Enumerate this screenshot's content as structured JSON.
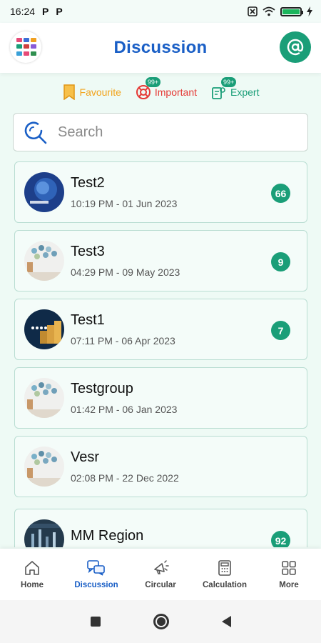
{
  "status_bar": {
    "time": "16:24",
    "notif_1": "P",
    "notif_2": "P"
  },
  "header": {
    "title": "Discussion"
  },
  "filters": {
    "favourite": {
      "label": "Favourite",
      "color": "#f2a31b"
    },
    "important": {
      "label": "Important",
      "badge": "99+",
      "color": "#e53935"
    },
    "expert": {
      "label": "Expert",
      "badge": "99+",
      "color": "#1a9e78"
    }
  },
  "search": {
    "placeholder": "Search"
  },
  "discussions": [
    {
      "title": "Test2",
      "time": "10:19 PM - 01 Jun 2023",
      "count": "66",
      "avatar": "ai-blue"
    },
    {
      "title": "Test3",
      "time": "04:29 PM - 09 May 2023",
      "count": "9",
      "avatar": "tree"
    },
    {
      "title": "Test1",
      "time": "07:11 PM - 06 Apr 2023",
      "count": "7",
      "avatar": "coins"
    },
    {
      "title": "Testgroup",
      "time": "01:42 PM - 06 Jan 2023",
      "count": "",
      "avatar": "tree"
    },
    {
      "title": "Vesr",
      "time": "02:08 PM - 22 Dec 2022",
      "count": "",
      "avatar": "tree"
    },
    {
      "title": "MM Region",
      "time": "",
      "count": "92",
      "avatar": "dark"
    }
  ],
  "bottom_nav": [
    {
      "label": "Home",
      "icon": "home-icon",
      "active": false
    },
    {
      "label": "Discussion",
      "icon": "chat-icon",
      "active": true
    },
    {
      "label": "Circular",
      "icon": "megaphone-icon",
      "active": false
    },
    {
      "label": "Calculation",
      "icon": "calculator-icon",
      "active": false
    },
    {
      "label": "More",
      "icon": "grid-icon",
      "active": false
    }
  ],
  "colors": {
    "brand_blue": "#1a5fc6",
    "accent_green": "#1a9e78",
    "background": "#eefaf5"
  }
}
